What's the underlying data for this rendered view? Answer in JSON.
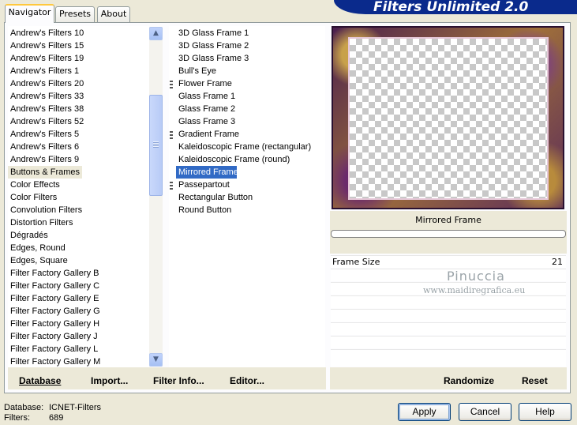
{
  "tabs": [
    {
      "label": "Navigator",
      "active": true
    },
    {
      "label": "Presets",
      "active": false
    },
    {
      "label": "About",
      "active": false
    }
  ],
  "brand_title": "Filters Unlimited 2.0",
  "categories": [
    "Andrew's Filters 10",
    "Andrew's Filters 15",
    "Andrew's Filters 19",
    "Andrew's Filters 1",
    "Andrew's Filters 20",
    "Andrew's Filters 33",
    "Andrew's Filters 38",
    "Andrew's Filters 52",
    "Andrew's Filters 5",
    "Andrew's Filters 6",
    "Andrew's Filters 9",
    "Buttons & Frames",
    "Color Effects",
    "Color Filters",
    "Convolution Filters",
    "Distortion Filters",
    "Dégradés",
    "Edges, Round",
    "Edges, Square",
    "Filter Factory Gallery B",
    "Filter Factory Gallery C",
    "Filter Factory Gallery E",
    "Filter Factory Gallery G",
    "Filter Factory Gallery H",
    "Filter Factory Gallery J",
    "Filter Factory Gallery L",
    "Filter Factory Gallery M"
  ],
  "selected_category": "Buttons & Frames",
  "filters": [
    {
      "label": "3D Glass Frame 1",
      "grip": false
    },
    {
      "label": "3D Glass Frame 2",
      "grip": false
    },
    {
      "label": "3D Glass Frame 3",
      "grip": false
    },
    {
      "label": "Bull's Eye",
      "grip": false
    },
    {
      "label": "Flower Frame",
      "grip": true
    },
    {
      "label": "Glass Frame 1",
      "grip": false
    },
    {
      "label": "Glass Frame 2",
      "grip": false
    },
    {
      "label": "Glass Frame 3",
      "grip": false
    },
    {
      "label": "Gradient Frame",
      "grip": true
    },
    {
      "label": "Kaleidoscopic Frame (rectangular)",
      "grip": false
    },
    {
      "label": "Kaleidoscopic Frame (round)",
      "grip": false
    },
    {
      "label": "Mirrored Frame",
      "grip": false
    },
    {
      "label": "Passepartout",
      "grip": true
    },
    {
      "label": "Rectangular Button",
      "grip": false
    },
    {
      "label": "Round Button",
      "grip": false
    }
  ],
  "selected_filter": "Mirrored Frame",
  "preview": {
    "filter_name": "Mirrored Frame",
    "params": [
      {
        "label": "Frame Size",
        "value": "21"
      }
    ],
    "watermark_name": "Pinuccia",
    "watermark_url": "www.maidiregrafica.eu"
  },
  "bottom_links": {
    "database": "Database",
    "import": "Import...",
    "filter_info": "Filter Info...",
    "editor": "Editor...",
    "randomize": "Randomize",
    "reset": "Reset"
  },
  "status": {
    "database_label": "Database:",
    "database_value": "ICNET-Filters",
    "filters_label": "Filters:",
    "filters_value": "689"
  },
  "buttons": {
    "apply": "Apply",
    "cancel": "Cancel",
    "help": "Help"
  }
}
